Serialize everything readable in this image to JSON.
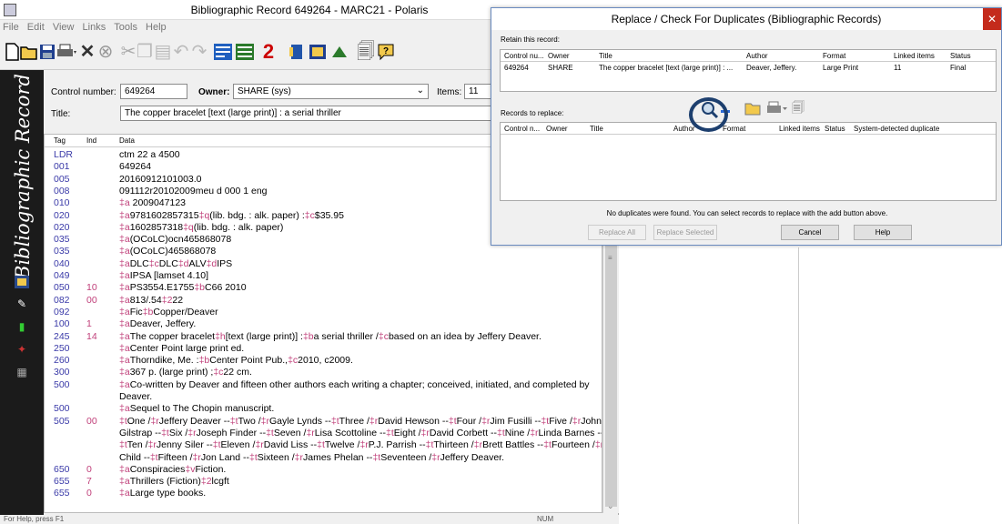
{
  "main_window": {
    "title": "Bibliographic Record 649264 - MARC21 - Polaris",
    "menu": [
      "File",
      "Edit",
      "View",
      "Links",
      "Tools",
      "Help"
    ],
    "sidebar_title": "Bibliographic Record"
  },
  "header": {
    "control_number_label": "Control number:",
    "control_number": "649264",
    "owner_label": "Owner:",
    "owner": "SHARE (sys)",
    "items_label": "Items:",
    "items": "11",
    "title_label": "Title:",
    "title": "The copper bracelet [text (large print)] : a serial thriller"
  },
  "marc_columns": [
    "Tag",
    "Ind",
    "Data"
  ],
  "marc_rows": [
    {
      "tag": "LDR",
      "ind": "",
      "data": "     ctm  22    a 4500"
    },
    {
      "tag": "001",
      "ind": "",
      "data": "649264"
    },
    {
      "tag": "005",
      "ind": "",
      "data": "20160912101003.0"
    },
    {
      "tag": "008",
      "ind": "",
      "data": "091112r20102009meu    d     000 1 eng"
    },
    {
      "tag": "010",
      "ind": "",
      "data": "‡a  2009047123"
    },
    {
      "tag": "020",
      "ind": "",
      "data": "‡a9781602857315‡q(lib. bdg. : alk. paper) :‡c$35.95"
    },
    {
      "tag": "020",
      "ind": "",
      "data": "‡a1602857318‡q(lib. bdg. : alk. paper)"
    },
    {
      "tag": "035",
      "ind": "",
      "data": "‡a(OCoLC)ocn465868078"
    },
    {
      "tag": "035",
      "ind": "",
      "data": "‡a(OCoLC)465868078"
    },
    {
      "tag": "040",
      "ind": "",
      "data": "‡aDLC‡cDLC‡dALV‡dIPS"
    },
    {
      "tag": "049",
      "ind": "",
      "data": "‡aIPSA [lamset 4.10]"
    },
    {
      "tag": "050",
      "ind": "10",
      "data": "‡aPS3554.E1755‡bC66 2010"
    },
    {
      "tag": "082",
      "ind": "00",
      "data": "‡a813/.54‡222"
    },
    {
      "tag": "092",
      "ind": "",
      "data": "‡aFic‡bCopper/Deaver"
    },
    {
      "tag": "100",
      "ind": "1",
      "data": "‡aDeaver, Jeffery."
    },
    {
      "tag": "245",
      "ind": "14",
      "data": "‡aThe copper bracelet‡h[text (large print)] :‡ba serial thriller /‡cbased on an idea by Jeffery Deaver."
    },
    {
      "tag": "250",
      "ind": "",
      "data": "‡aCenter Point large print ed."
    },
    {
      "tag": "260",
      "ind": "",
      "data": "‡aThorndike, Me. :‡bCenter Point Pub.,‡c2010, c2009."
    },
    {
      "tag": "300",
      "ind": "",
      "data": "‡a367 p. (large print) ;‡c22 cm."
    },
    {
      "tag": "500",
      "ind": "",
      "data": "‡aCo-written by Deaver and fifteen other authors each writing a chapter; conceived, initiated, and completed by"
    },
    {
      "tag": "",
      "ind": "",
      "data": "Deaver."
    },
    {
      "tag": "500",
      "ind": "",
      "data": "‡aSequel to The Chopin manuscript."
    },
    {
      "tag": "505",
      "ind": "00",
      "data": "‡tOne /‡rJeffery Deaver --‡tTwo /‡rGayle Lynds --‡tThree /‡rDavid Hewson --‡tFour /‡rJim Fusilli --‡tFive /‡rJohn"
    },
    {
      "tag": "",
      "ind": "",
      "data": "Gilstrap --‡tSix /‡rJoseph Finder --‡tSeven /‡rLisa Scottoline --‡tEight /‡rDavid Corbett --‡tNine /‡rLinda Barnes --"
    },
    {
      "tag": "",
      "ind": "",
      "data": "‡tTen /‡rJenny Siler --‡tEleven /‡rDavid Liss --‡tTwelve /‡rP.J. Parrish --‡tThirteen /‡rBrett Battles --‡tFourteen /‡rLee"
    },
    {
      "tag": "",
      "ind": "",
      "data": "Child --‡tFifteen /‡rJon Land --‡tSixteen /‡rJames Phelan --‡tSeventeen /‡rJeffery Deaver."
    },
    {
      "tag": "650",
      "ind": "0",
      "data": "‡aConspiracies‡vFiction."
    },
    {
      "tag": "655",
      "ind": "7",
      "data": "‡aThrillers (Fiction)‡2lcgft"
    },
    {
      "tag": "655",
      "ind": "0",
      "data": "‡aLarge type books."
    }
  ],
  "status_bar": {
    "left": "For Help, press F1",
    "right": "NUM"
  },
  "dialog": {
    "title": "Replace / Check For Duplicates (Bibliographic Records)",
    "retain_label": "Retain this record:",
    "retain_columns": [
      "Control nu...",
      "Owner",
      "Title",
      "Author",
      "Format",
      "Linked items",
      "Status"
    ],
    "retain_row": [
      "649264",
      "SHARE",
      "The copper bracelet [text (large print)] : ...",
      "Deaver, Jeffery.",
      "Large Print",
      "11",
      "Final"
    ],
    "replace_label": "Records to replace:",
    "replace_columns": [
      "Control n...",
      "Owner",
      "Title",
      "Author",
      "Format",
      "Linked items",
      "Status",
      "System-detected duplicate"
    ],
    "message": "No duplicates were found.  You can select records to replace with the add button above.",
    "buttons": {
      "replace_all": "Replace All",
      "replace_selected": "Replace Selected",
      "cancel": "Cancel",
      "help": "Help"
    }
  },
  "colors": {
    "tag": "#3a3aa8",
    "indicator": "#c0407a",
    "sidebar": "#1b1b1b",
    "highlight_circle": "#1d3f6e"
  }
}
